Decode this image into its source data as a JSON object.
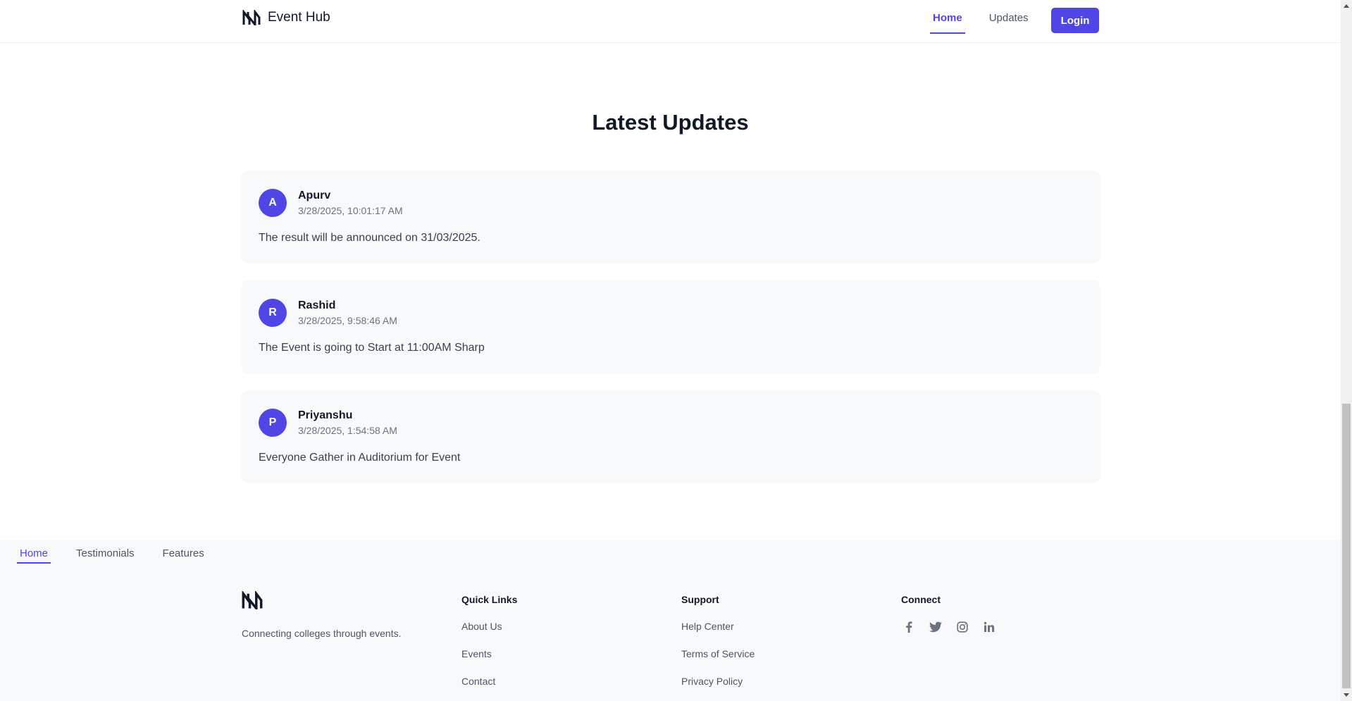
{
  "navbar": {
    "brand_name": "Event Hub",
    "links": {
      "home": "Home",
      "updates": "Updates"
    },
    "login_label": "Login",
    "accent_color": "#4f46e5"
  },
  "main": {
    "title": "Latest Updates",
    "updates": [
      {
        "initial": "A",
        "author": "Apurv",
        "timestamp": "3/28/2025, 10:01:17 AM",
        "message": "The result will be announced on 31/03/2025."
      },
      {
        "initial": "R",
        "author": "Rashid",
        "timestamp": "3/28/2025, 9:58:46 AM",
        "message": "The Event is going to Start at 11:00AM Sharp"
      },
      {
        "initial": "P",
        "author": "Priyanshu",
        "timestamp": "3/28/2025, 1:54:58 AM",
        "message": "Everyone Gather in Auditorium for Event"
      }
    ]
  },
  "footer": {
    "tabs": {
      "home": "Home",
      "testimonials": "Testimonials",
      "features": "Features"
    },
    "tagline": "Connecting colleges through events.",
    "quick_links": {
      "title": "Quick Links",
      "about": "About Us",
      "events": "Events",
      "contact": "Contact"
    },
    "support": {
      "title": "Support",
      "help": "Help Center",
      "terms": "Terms of Service",
      "privacy": "Privacy Policy"
    },
    "connect": {
      "title": "Connect",
      "icons": [
        "facebook-icon",
        "twitter-icon",
        "instagram-icon",
        "linkedin-icon"
      ]
    }
  }
}
